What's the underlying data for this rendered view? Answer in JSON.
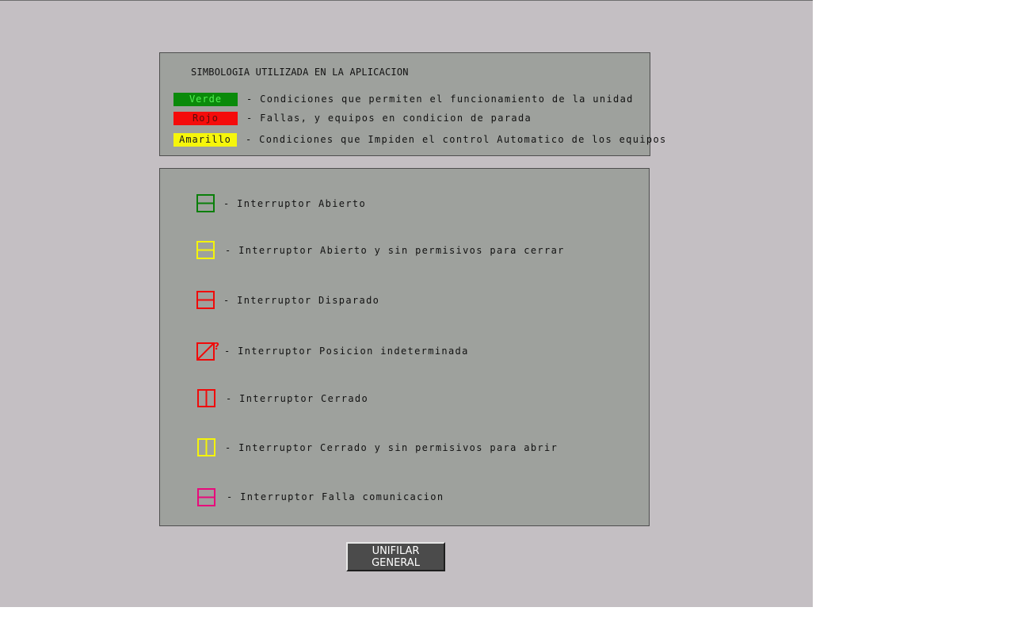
{
  "legend": {
    "title": "SIMBOLOGIA UTILIZADA EN LA APLICACION",
    "colors": [
      {
        "label": "Verde",
        "description": "- Condiciones que permiten el funcionamiento de la unidad",
        "color": "#0a8a0a"
      },
      {
        "label": "Rojo",
        "description": "- Fallas, y equipos en condicion de parada",
        "color": "#f50b0b"
      },
      {
        "label": "Amarillo",
        "description": "- Condiciones que Impiden el control Automatico de los equipos",
        "color": "#f6f60b"
      }
    ]
  },
  "symbols": [
    {
      "icon": "breaker-open-green-icon",
      "color": "#0a7f0a",
      "label": "- Interruptor Abierto"
    },
    {
      "icon": "breaker-open-yellow-icon",
      "color": "#f4f40a",
      "label": "- Interruptor Abierto y sin permisivos para cerrar"
    },
    {
      "icon": "breaker-tripped-red-icon",
      "color": "#f00a0a",
      "label": "- Interruptor Disparado"
    },
    {
      "icon": "breaker-indeterminate-red-icon",
      "color": "#f00a0a",
      "label": "- Interruptor Posicion indeterminada"
    },
    {
      "icon": "breaker-closed-red-icon",
      "color": "#f00a0a",
      "label": "- Interruptor Cerrado"
    },
    {
      "icon": "breaker-closed-yellow-icon",
      "color": "#f4f40a",
      "label": "- Interruptor Cerrado y sin permisivos para abrir"
    },
    {
      "icon": "breaker-communication-fault-magenta-icon",
      "color": "#e80a7b",
      "label": "- Interruptor Falla comunicacion"
    }
  ],
  "button": {
    "line1": "UNIFILAR",
    "line2": "GENERAL"
  }
}
